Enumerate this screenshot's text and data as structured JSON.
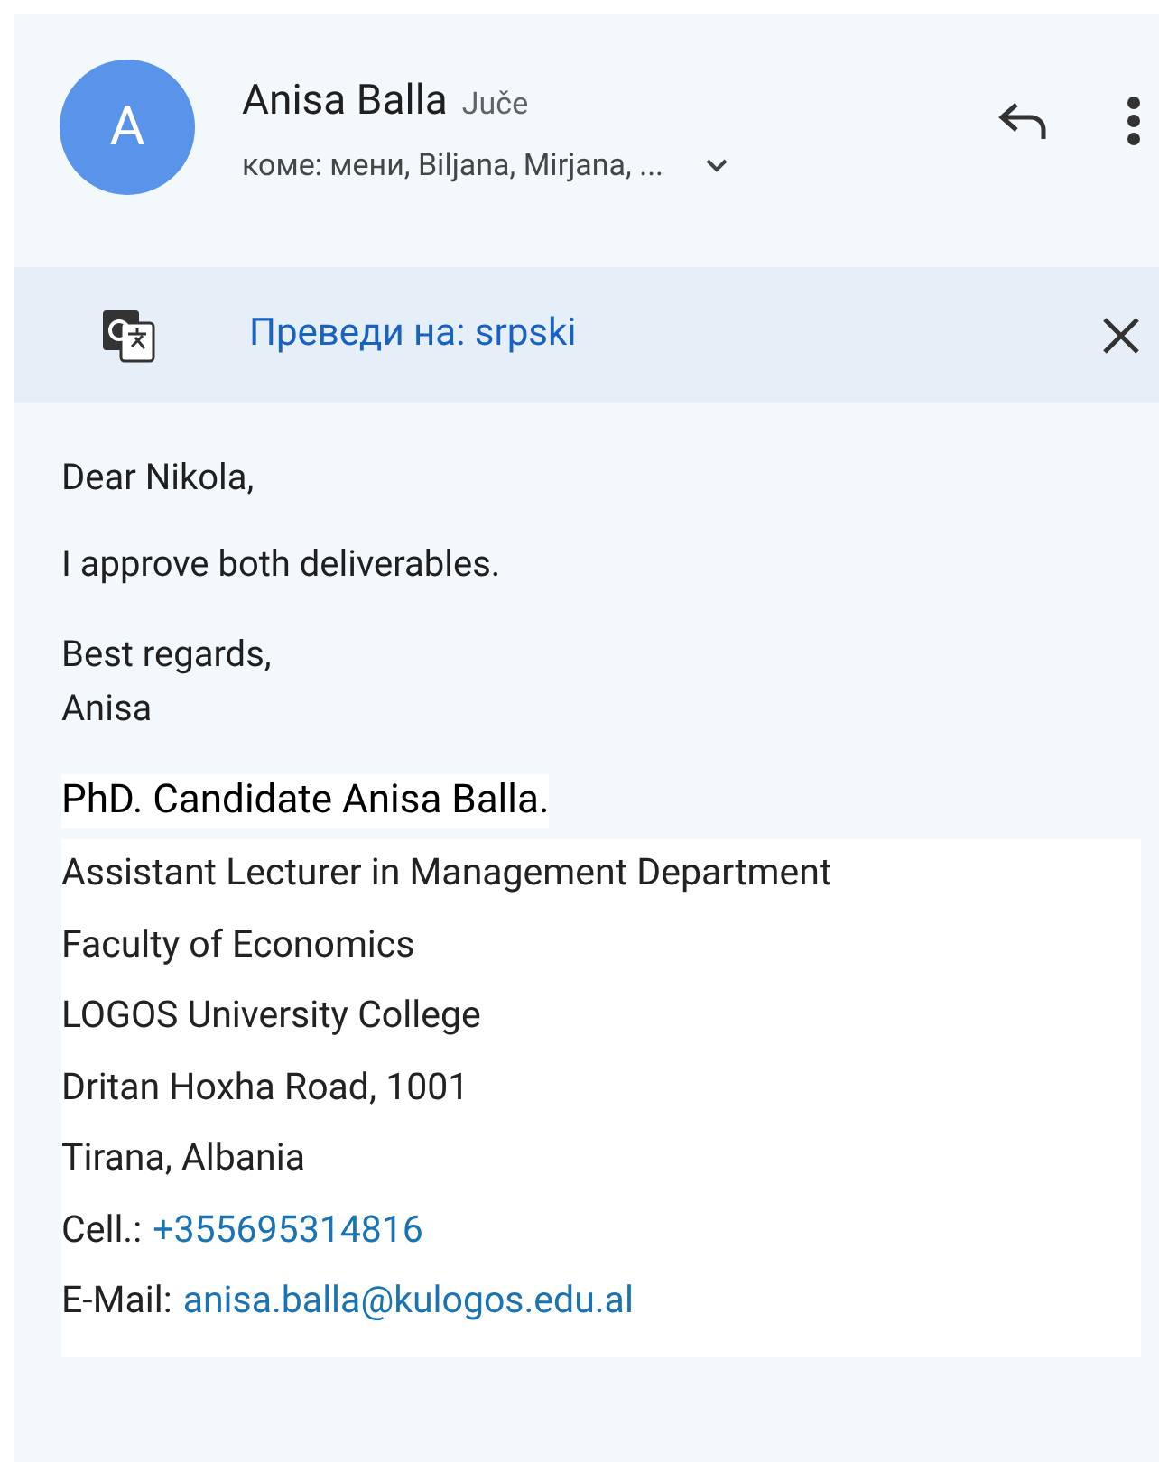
{
  "header": {
    "avatar_letter": "A",
    "sender": "Anisa Balla",
    "date": "Juče",
    "recipients": "коме: мени, Biljana, Mirjana, ..."
  },
  "translate_bar": {
    "label": "Преведи на: srpski"
  },
  "body": [
    "Dear Nikola,",
    "I approve both deliverables."
  ],
  "closing": [
    "Best regards,",
    "Anisa"
  ],
  "signature": {
    "title": "PhD. Candidate Anisa Balla.",
    "lines": [
      {
        "text": "Assistant Lecturer in Management Department"
      },
      {
        "text": "Faculty of Economics"
      },
      {
        "text": "LOGOS University College"
      },
      {
        "text": "Dritan Hoxha Road, 1001"
      },
      {
        "text": "Tirana, Albania"
      },
      {
        "text": "Cell.:",
        "link": "+355695314816"
      },
      {
        "text": "E-Mail:",
        "link": "anisa.balla@kulogos.edu.al"
      }
    ]
  }
}
